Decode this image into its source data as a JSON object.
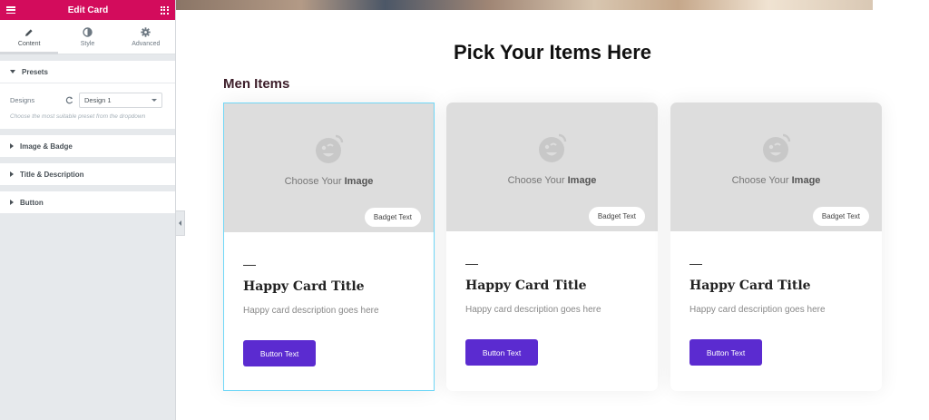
{
  "editor": {
    "title": "Edit Card",
    "tabs": [
      {
        "label": "Content",
        "icon": "pencil-icon"
      },
      {
        "label": "Style",
        "icon": "contrast-icon"
      },
      {
        "label": "Advanced",
        "icon": "gear-icon"
      }
    ],
    "sections": {
      "presets": {
        "label": "Presets",
        "designs_label": "Designs",
        "design_value": "Design 1",
        "help": "Choose the most suitable preset from the dropdown"
      },
      "image_badge": "Image & Badge",
      "title_description": "Title & Description",
      "button": "Button"
    },
    "accent_color": "#d30c5c"
  },
  "preview": {
    "page_title": "Pick Your Items Here",
    "section_title": "Men Items",
    "cards": [
      {
        "choose_prefix": "Choose Your",
        "choose_strong": "Image",
        "badge": "Badget Text",
        "title": "Happy Card Title",
        "description": "Happy card description goes here",
        "button": "Button Text"
      },
      {
        "choose_prefix": "Choose Your",
        "choose_strong": "Image",
        "badge": "Badget Text",
        "title": "Happy Card Title",
        "description": "Happy card description goes here",
        "button": "Button Text"
      },
      {
        "choose_prefix": "Choose Your",
        "choose_strong": "Image",
        "badge": "Badget Text",
        "title": "Happy Card Title",
        "description": "Happy card description goes here",
        "button": "Button Text"
      }
    ],
    "button_color": "#5b2bd0"
  }
}
